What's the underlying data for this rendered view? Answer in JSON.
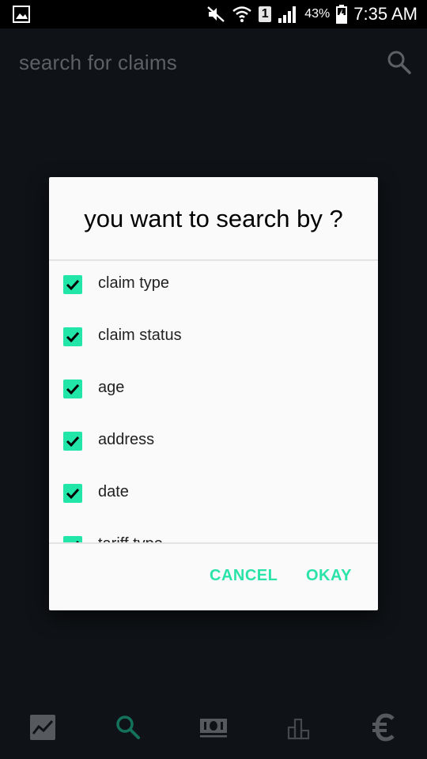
{
  "status_bar": {
    "battery_percent": "43%",
    "time": "7:35 AM",
    "sim_slot": "1",
    "icons": [
      "gallery-icon",
      "mute-icon",
      "wifi-icon",
      "signal-icon",
      "battery-icon"
    ]
  },
  "app_bar": {
    "title": "search for claims",
    "action_icon": "search-icon"
  },
  "dialog": {
    "title": "you want to search by ?",
    "options": [
      {
        "label": "claim type",
        "checked": true
      },
      {
        "label": "claim status",
        "checked": true
      },
      {
        "label": "age",
        "checked": true
      },
      {
        "label": "address",
        "checked": true
      },
      {
        "label": "date",
        "checked": true
      },
      {
        "label": "tariff type",
        "checked": true
      }
    ],
    "cancel_label": "CANCEL",
    "okay_label": "OKAY"
  },
  "bottom_nav": {
    "items": [
      {
        "icon": "trend-chart-icon",
        "active": false
      },
      {
        "icon": "search-icon",
        "active": true
      },
      {
        "icon": "money-icon",
        "active": false
      },
      {
        "icon": "bar-chart-icon",
        "active": false
      },
      {
        "icon": "euro-icon",
        "active": false
      }
    ]
  },
  "colors": {
    "accent": "#22e6a8",
    "background": "#0f1216",
    "dialog_bg": "#fafafa"
  }
}
